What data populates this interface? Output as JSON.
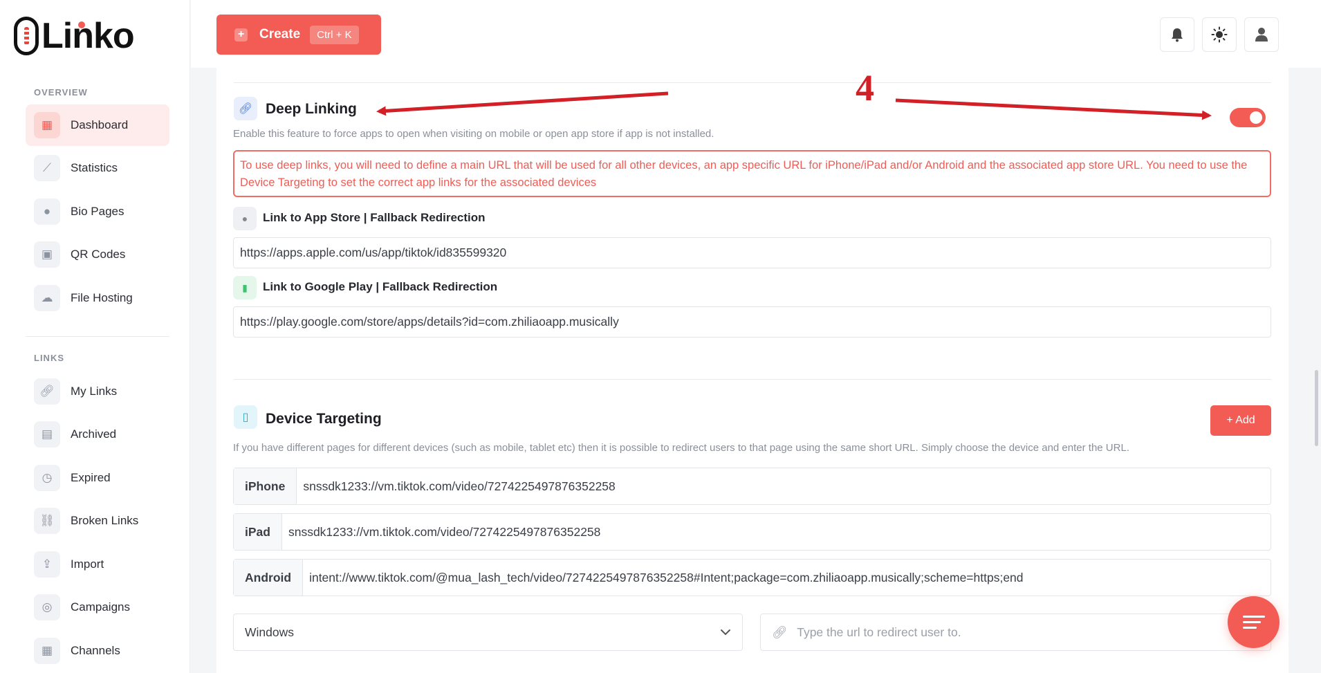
{
  "brand": {
    "name": "Linko"
  },
  "header": {
    "create_label": "Create",
    "create_shortcut": "Ctrl + K",
    "icons": [
      "bell-icon",
      "sun-icon",
      "user-icon"
    ]
  },
  "sidebar": {
    "overview_label": "OVERVIEW",
    "links_label": "LINKS",
    "overview_items": [
      {
        "label": "Dashboard",
        "icon": "dashboard-icon",
        "active": true
      },
      {
        "label": "Statistics",
        "icon": "chart-icon"
      },
      {
        "label": "Bio Pages",
        "icon": "bio-pages-icon"
      },
      {
        "label": "QR Codes",
        "icon": "qr-code-icon"
      },
      {
        "label": "File Hosting",
        "icon": "cloud-icon"
      }
    ],
    "link_items": [
      {
        "label": "My Links",
        "icon": "link-icon"
      },
      {
        "label": "Archived",
        "icon": "archive-icon"
      },
      {
        "label": "Expired",
        "icon": "clock-icon"
      },
      {
        "label": "Broken Links",
        "icon": "broken-link-icon"
      },
      {
        "label": "Import",
        "icon": "import-icon"
      },
      {
        "label": "Campaigns",
        "icon": "campaign-icon"
      },
      {
        "label": "Channels",
        "icon": "channels-icon"
      }
    ]
  },
  "deep_linking": {
    "title": "Deep Linking",
    "description": "Enable this feature to force apps to open when visiting on mobile or open app store if app is not installed.",
    "enabled": true,
    "alert": "To use deep links, you will need to define a main URL that will be used for all other devices, an app specific URL for iPhone/iPad and/or Android and the associated app store URL. You need to use the Device Targeting to set the correct app links for the associated devices",
    "app_store_label": "Link to App Store | Fallback Redirection",
    "app_store_url": "https://apps.apple.com/us/app/tiktok/id835599320",
    "google_play_label": "Link to Google Play | Fallback Redirection",
    "google_play_url": "https://play.google.com/store/apps/details?id=com.zhiliaoapp.musically"
  },
  "device_targeting": {
    "title": "Device Targeting",
    "add_label": "+ Add",
    "description": "If you have different pages for different devices (such as mobile, tablet etc) then it is possible to redirect users to that page using the same short URL. Simply choose the device and enter the URL.",
    "rows": [
      {
        "device": "iPhone",
        "url": "snssdk1233://vm.tiktok.com/video/7274225497876352258"
      },
      {
        "device": "iPad",
        "url": "snssdk1233://vm.tiktok.com/video/7274225497876352258"
      },
      {
        "device": "Android",
        "url": "intent://www.tiktok.com/@mua_lash_tech/video/7274225497876352258#Intent;package=com.zhiliaoapp.musically;scheme=https;end"
      }
    ],
    "select_value": "Windows",
    "url_placeholder": "Type the url to redirect user to."
  },
  "annotation": {
    "number": "4"
  },
  "colors": {
    "accent": "#f25c54",
    "alert": "#ee5d55",
    "annotation": "#d31f26"
  }
}
